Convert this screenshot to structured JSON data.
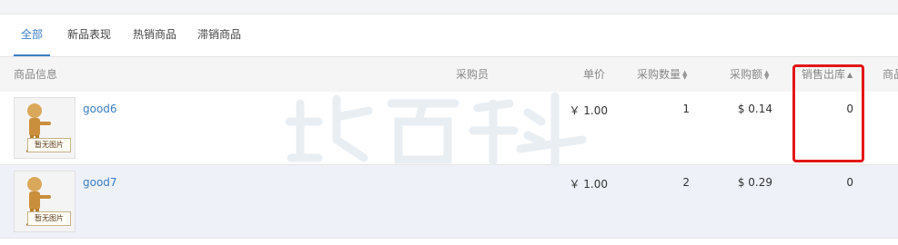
{
  "tabs": [
    {
      "label": "全部",
      "active": true
    },
    {
      "label": "新品表现",
      "active": false
    },
    {
      "label": "热销商品",
      "active": false
    },
    {
      "label": "滞销商品",
      "active": false
    }
  ],
  "table": {
    "headers": {
      "product_info": "商品信息",
      "buyer": "采购员",
      "unit_price": "单价",
      "purchase_qty": "采购数量",
      "purchase_amount": "采购额",
      "sales_out": "销售出库",
      "next_col": "商品"
    },
    "placeholder_image_label": "暂无图片",
    "rows": [
      {
        "name": "good6",
        "unit_price": "￥ 1.00",
        "purchase_qty": "1",
        "purchase_amount": "$ 0.14",
        "sales_out": "0"
      },
      {
        "name": "good7",
        "unit_price": "￥ 1.00",
        "purchase_qty": "2",
        "purchase_amount": "$ 0.29",
        "sales_out": "0"
      }
    ]
  },
  "colors": {
    "accent": "#3b7ec2",
    "highlight": "#e31717",
    "header_bg": "#f5f5f5",
    "row_alt_bg": "#eef1f8"
  }
}
